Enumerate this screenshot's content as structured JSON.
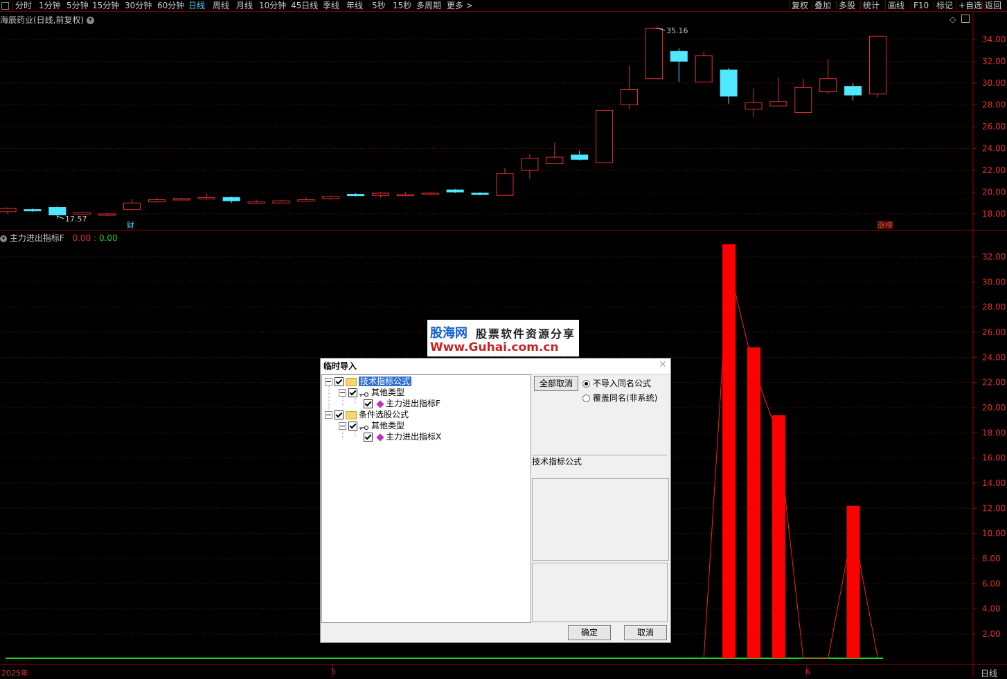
{
  "toolbar": {
    "periods": [
      "分时",
      "1分钟",
      "5分钟",
      "15分钟",
      "30分钟",
      "60分钟",
      "日线",
      "周线",
      "月线",
      "10分钟",
      "45日线",
      "季线",
      "年线",
      "5秒",
      "15秒",
      "多周期",
      "更多 >"
    ],
    "active_period": "日线",
    "right_buttons": [
      "复权",
      "叠加",
      "多股",
      "统计",
      "画线",
      "F10",
      "标记",
      "+自选",
      "返回"
    ]
  },
  "price_panel": {
    "title": "海辰药业(日线,前复权)",
    "high_label": "35.16",
    "low_label": "17.57",
    "badge_cai": "财",
    "badge_zhangting": "涨榜",
    "y_ticks": [
      "34.00",
      "32.00",
      "30.00",
      "28.00",
      "26.00",
      "24.00",
      "22.00",
      "20.00",
      "18.00"
    ],
    "candles": [
      {
        "o": 18.2,
        "c": 18.5,
        "h": 18.6,
        "l": 18.0
      },
      {
        "o": 18.4,
        "c": 18.3,
        "h": 18.5,
        "l": 18.2
      },
      {
        "o": 18.6,
        "c": 17.9,
        "h": 18.7,
        "l": 17.57
      },
      {
        "o": 18.0,
        "c": 18.1,
        "h": 18.2,
        "l": 17.9
      },
      {
        "o": 17.9,
        "c": 18.0,
        "h": 18.1,
        "l": 17.8
      },
      {
        "o": 18.4,
        "c": 19.0,
        "h": 19.4,
        "l": 18.3
      },
      {
        "o": 19.1,
        "c": 19.3,
        "h": 19.5,
        "l": 19.0
      },
      {
        "o": 19.3,
        "c": 19.4,
        "h": 19.5,
        "l": 19.2
      },
      {
        "o": 19.5,
        "c": 19.5,
        "h": 19.9,
        "l": 19.3
      },
      {
        "o": 19.5,
        "c": 19.2,
        "h": 19.6,
        "l": 19.0
      },
      {
        "o": 19.1,
        "c": 19.1,
        "h": 19.3,
        "l": 18.9
      },
      {
        "o": 19.0,
        "c": 19.2,
        "h": 19.3,
        "l": 19.0
      },
      {
        "o": 19.2,
        "c": 19.3,
        "h": 19.5,
        "l": 19.1
      },
      {
        "o": 19.4,
        "c": 19.6,
        "h": 19.7,
        "l": 19.3
      },
      {
        "o": 19.8,
        "c": 19.7,
        "h": 19.9,
        "l": 19.6
      },
      {
        "o": 19.7,
        "c": 19.9,
        "h": 20.0,
        "l": 19.5
      },
      {
        "o": 19.8,
        "c": 19.8,
        "h": 20.0,
        "l": 19.6
      },
      {
        "o": 19.8,
        "c": 19.9,
        "h": 20.0,
        "l": 19.7
      },
      {
        "o": 20.2,
        "c": 20.0,
        "h": 20.3,
        "l": 19.9
      },
      {
        "o": 19.9,
        "c": 19.8,
        "h": 20.0,
        "l": 19.7
      },
      {
        "o": 19.7,
        "c": 21.7,
        "h": 22.2,
        "l": 19.7
      },
      {
        "o": 22.0,
        "c": 23.1,
        "h": 23.5,
        "l": 21.2
      },
      {
        "o": 22.6,
        "c": 23.2,
        "h": 24.5,
        "l": 22.6
      },
      {
        "o": 23.4,
        "c": 23.0,
        "h": 23.8,
        "l": 22.9
      },
      {
        "o": 22.7,
        "c": 27.5,
        "h": 27.5,
        "l": 22.7
      },
      {
        "o": 28.0,
        "c": 29.4,
        "h": 31.6,
        "l": 27.6
      },
      {
        "o": 30.4,
        "c": 35.0,
        "h": 35.16,
        "l": 30.4
      },
      {
        "o": 32.9,
        "c": 32.0,
        "h": 33.2,
        "l": 30.1
      },
      {
        "o": 30.1,
        "c": 32.5,
        "h": 32.9,
        "l": 30.1
      },
      {
        "o": 31.2,
        "c": 28.8,
        "h": 31.4,
        "l": 28.1
      },
      {
        "o": 27.6,
        "c": 28.2,
        "h": 29.5,
        "l": 26.9
      },
      {
        "o": 27.9,
        "c": 28.3,
        "h": 30.5,
        "l": 27.9
      },
      {
        "o": 27.3,
        "c": 29.6,
        "h": 30.4,
        "l": 27.3
      },
      {
        "o": 29.2,
        "c": 30.4,
        "h": 32.2,
        "l": 29.0
      },
      {
        "o": 29.7,
        "c": 28.9,
        "h": 30.0,
        "l": 28.4
      },
      {
        "o": 29.0,
        "c": 34.3,
        "h": 34.3,
        "l": 28.7
      }
    ]
  },
  "indicator_panel": {
    "title": "主力进出指标F",
    "value1": "0.00",
    "value2": "0.00",
    "y_ticks": [
      "32.00",
      "30.00",
      "28.00",
      "26.00",
      "24.00",
      "22.00",
      "20.00",
      "18.00",
      "16.00",
      "14.00",
      "12.00",
      "10.00",
      "8.00",
      "6.00",
      "4.00",
      "2.00"
    ],
    "bars": [
      {
        "index": 29,
        "value": 33.0
      },
      {
        "index": 30,
        "value": 24.8
      },
      {
        "index": 31,
        "value": 19.4
      },
      {
        "index": 34,
        "value": 12.2
      }
    ]
  },
  "x_axis": {
    "labels": [
      "2025年",
      "5",
      "6"
    ],
    "right_label": "日线"
  },
  "watermark": {
    "line1": "股海网",
    "line2": "股票软件资源分享",
    "line3": "Www.Guhai.com.cn"
  },
  "dialog": {
    "title": "临时导入",
    "tree": [
      {
        "level": 0,
        "label": "技术指标公式",
        "selected": true,
        "type": "folder"
      },
      {
        "level": 1,
        "label": "其他类型",
        "type": "key"
      },
      {
        "level": 2,
        "label": "主力进出指标F",
        "type": "formula"
      },
      {
        "level": 0,
        "label": "条件选股公式",
        "type": "folder"
      },
      {
        "level": 1,
        "label": "其他类型",
        "type": "key"
      },
      {
        "level": 2,
        "label": "主力进出指标X",
        "type": "formula"
      }
    ],
    "deselect_all": "全部取消",
    "radio1": "不导入同名公式",
    "radio2": "覆盖同名(非系统)",
    "info_label": "技术指标公式",
    "ok": "确定",
    "cancel": "取消"
  },
  "colors": {
    "up": "#e03030",
    "down": "#4fe8ff",
    "grid": "#7a0000",
    "zero_line": "#20d020"
  }
}
